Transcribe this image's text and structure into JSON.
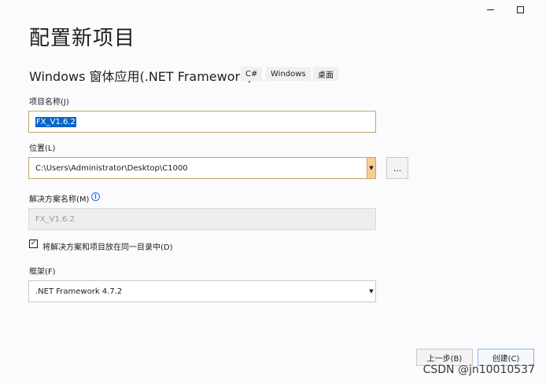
{
  "window": {
    "minimize_icon": "minimize-icon",
    "maximize_icon": "maximize-icon"
  },
  "page": {
    "title": "配置新项目",
    "template_name": "Windows 窗体应用(.NET Framework)",
    "tags": [
      "C#",
      "Windows",
      "桌面"
    ]
  },
  "project_name": {
    "label": "项目名称(J)",
    "value": "FX_V1.6.2"
  },
  "location": {
    "label": "位置(L)",
    "value": "C:\\Users\\Administrator\\Desktop\\C1000",
    "browse_label": "..."
  },
  "solution_name": {
    "label": "解决方案名称(M)",
    "info_icon": "info-icon",
    "info_glyph": "i",
    "value": "FX_V1.6.2"
  },
  "same_dir": {
    "label": "将解决方案和项目放在同一目录中(D)",
    "checked": true,
    "check_glyph": "✓"
  },
  "framework": {
    "label": "框架(F)",
    "value": ".NET Framework 4.7.2"
  },
  "buttons": {
    "back": "上一步(B)",
    "create": "创建(C)"
  },
  "watermark": "CSDN @jn10010537",
  "colors": {
    "accent_orange": "#f6ce8f",
    "selection_blue": "#0a64c8",
    "info_blue": "#2e6ad4"
  }
}
